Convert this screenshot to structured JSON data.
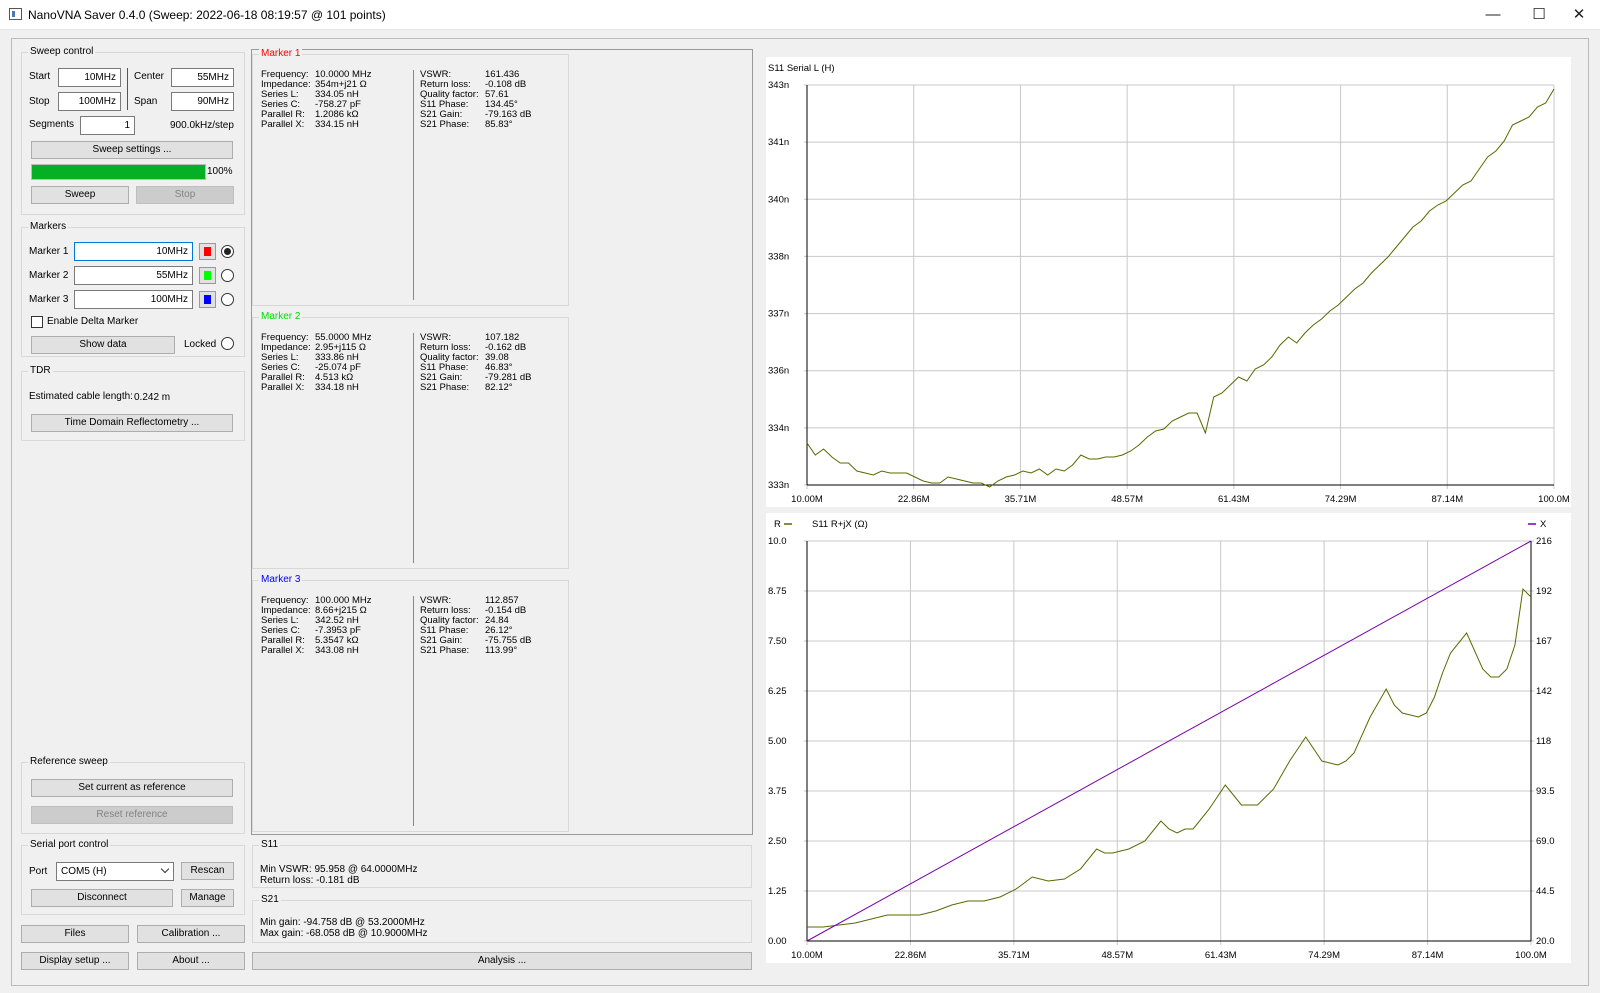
{
  "window": {
    "title": "NanoVNA Saver 0.4.0 (Sweep: 2022-06-18 08:19:57 @ 101 points)"
  },
  "sweep_control": {
    "title": "Sweep control",
    "start_label": "Start",
    "start": "10MHz",
    "center_label": "Center",
    "center": "55MHz",
    "stop_label": "Stop",
    "stop": "100MHz",
    "span_label": "Span",
    "span": "90MHz",
    "segments_label": "Segments",
    "segments": "1",
    "step": "900.0kHz/step",
    "settings_button": "Sweep settings ...",
    "progress": 100,
    "progress_label": "100%",
    "sweep_button": "Sweep",
    "stop_button": "Stop"
  },
  "markers": {
    "title": "Markers",
    "items": [
      {
        "label": "Marker 1",
        "value": "10MHz",
        "color": "#ff0000",
        "selected": true
      },
      {
        "label": "Marker 2",
        "value": "55MHz",
        "color": "#00ff00",
        "selected": false
      },
      {
        "label": "Marker 3",
        "value": "100MHz",
        "color": "#0000ff",
        "selected": false
      }
    ],
    "delta_label": "Enable Delta Marker",
    "show_data": "Show data",
    "locked": "Locked"
  },
  "tdr": {
    "title": "TDR",
    "cable_label": "Estimated cable length:",
    "cable_value": "0.242 m",
    "button": "Time Domain Reflectometry ..."
  },
  "reference": {
    "title": "Reference sweep",
    "set_button": "Set current as reference",
    "reset_button": "Reset reference"
  },
  "serial": {
    "title": "Serial port control",
    "port_label": "Port",
    "port_value": "COM5 (H)",
    "rescan": "Rescan",
    "disconnect": "Disconnect",
    "manage": "Manage"
  },
  "bottom_buttons": {
    "files": "Files",
    "calibration": "Calibration ...",
    "display": "Display setup ...",
    "about": "About ...",
    "analysis": "Analysis ..."
  },
  "marker_panels": [
    {
      "title": "Marker 1",
      "color": "#ff0000",
      "left": [
        [
          "Frequency:",
          "10.0000 MHz"
        ],
        [
          "Impedance:",
          "354m+j21 Ω"
        ],
        [
          "Series L:",
          "334.05 nH"
        ],
        [
          "Series C:",
          "-758.27 pF"
        ],
        [
          "Parallel R:",
          "1.2086 kΩ"
        ],
        [
          "Parallel X:",
          "334.15 nH"
        ]
      ],
      "right": [
        [
          "VSWR:",
          "161.436"
        ],
        [
          "Return loss:",
          "-0.108 dB"
        ],
        [
          "Quality factor:",
          "57.61"
        ],
        [
          "S11 Phase:",
          "134.45°"
        ],
        [
          "S21 Gain:",
          "-79.163 dB"
        ],
        [
          "S21 Phase:",
          "85.83°"
        ]
      ]
    },
    {
      "title": "Marker 2",
      "color": "#00ff00",
      "left": [
        [
          "Frequency:",
          "55.0000 MHz"
        ],
        [
          "Impedance:",
          "2.95+j115 Ω"
        ],
        [
          "Series L:",
          "333.86 nH"
        ],
        [
          "Series C:",
          "-25.074 pF"
        ],
        [
          "Parallel R:",
          "4.513 kΩ"
        ],
        [
          "Parallel X:",
          "334.18 nH"
        ]
      ],
      "right": [
        [
          "VSWR:",
          "107.182"
        ],
        [
          "Return loss:",
          "-0.162 dB"
        ],
        [
          "Quality factor:",
          "39.08"
        ],
        [
          "S11 Phase:",
          "46.83°"
        ],
        [
          "S21 Gain:",
          "-79.281 dB"
        ],
        [
          "S21 Phase:",
          "82.12°"
        ]
      ]
    },
    {
      "title": "Marker 3",
      "color": "#0000ff",
      "left": [
        [
          "Frequency:",
          "100.000 MHz"
        ],
        [
          "Impedance:",
          "8.66+j215 Ω"
        ],
        [
          "Series L:",
          "342.52 nH"
        ],
        [
          "Series C:",
          "-7.3953 pF"
        ],
        [
          "Parallel R:",
          "5.3547 kΩ"
        ],
        [
          "Parallel X:",
          "343.08 nH"
        ]
      ],
      "right": [
        [
          "VSWR:",
          "112.857"
        ],
        [
          "Return loss:",
          "-0.154 dB"
        ],
        [
          "Quality factor:",
          "24.84"
        ],
        [
          "S11 Phase:",
          "26.12°"
        ],
        [
          "S21 Gain:",
          "-75.755 dB"
        ],
        [
          "S21 Phase:",
          "113.99°"
        ]
      ]
    }
  ],
  "s11_summary": {
    "title": "S11",
    "line1": "Min VSWR:  95.958 @ 64.0000MHz",
    "line2": "Return loss:  -0.181 dB"
  },
  "s21_summary": {
    "title": "S21",
    "line1": "Min gain:  -94.758 dB @ 53.2000MHz",
    "line2": "Max gain:  -68.058 dB @ 10.9000MHz"
  },
  "colors": {
    "trace": "#556b00",
    "x_trace": "#7700aa",
    "grid": "#c8c8c8"
  },
  "chart_data": [
    {
      "type": "line",
      "title": "S11 Serial L (H)",
      "x_ticks": [
        "10.00M",
        "22.86M",
        "35.71M",
        "48.57M",
        "61.43M",
        "74.29M",
        "87.14M",
        "100.0M"
      ],
      "y_ticks": [
        "343n",
        "341n",
        "340n",
        "338n",
        "337n",
        "336n",
        "334n",
        "333n"
      ],
      "xlim": [
        10,
        100
      ],
      "ylim": [
        333,
        343
      ],
      "series": [
        {
          "x": [
            10,
            11,
            12,
            13,
            14,
            15,
            16,
            17,
            18,
            19,
            20,
            21,
            22,
            23,
            24,
            25,
            26,
            27,
            28,
            29,
            30,
            31,
            32,
            33,
            34,
            35,
            36,
            37,
            38,
            39,
            40,
            41,
            42,
            43,
            44,
            45,
            46,
            47,
            48,
            49,
            50,
            51,
            52,
            53,
            54,
            55,
            56,
            57,
            58,
            59,
            60,
            61,
            62,
            63,
            64,
            65,
            66,
            67,
            68,
            69,
            70,
            71,
            72,
            73,
            74,
            75,
            76,
            77,
            78,
            79,
            80,
            81,
            82,
            83,
            84,
            85,
            86,
            87,
            88,
            89,
            90,
            91,
            92,
            93,
            94,
            95,
            96,
            97,
            98,
            99,
            100
          ],
          "values": [
            334.05,
            333.75,
            333.9,
            333.7,
            333.55,
            333.55,
            333.35,
            333.3,
            333.25,
            333.35,
            333.3,
            333.3,
            333.3,
            333.2,
            333.1,
            333.05,
            333.05,
            333.2,
            333.15,
            333.1,
            333.05,
            333.05,
            332.95,
            333.1,
            333.2,
            333.25,
            333.35,
            333.3,
            333.4,
            333.25,
            333.4,
            333.35,
            333.5,
            333.75,
            333.65,
            333.65,
            333.7,
            333.7,
            333.75,
            333.85,
            334,
            334.2,
            334.35,
            334.4,
            334.6,
            334.7,
            334.8,
            334.8,
            334.3,
            335.2,
            335.3,
            335.5,
            335.7,
            335.6,
            335.9,
            336,
            336.2,
            336.5,
            336.7,
            336.55,
            336.8,
            337,
            337.15,
            337.35,
            337.5,
            337.7,
            337.9,
            338.05,
            338.3,
            338.5,
            338.7,
            338.95,
            339.2,
            339.45,
            339.6,
            339.85,
            340,
            340.1,
            340.3,
            340.5,
            340.6,
            340.9,
            341.2,
            341.35,
            341.6,
            342,
            342.1,
            342.2,
            342.45,
            342.55,
            342.9
          ]
        }
      ]
    },
    {
      "type": "line",
      "title": "S11 R+jX (Ω)",
      "legend": [
        "R",
        "X"
      ],
      "x_ticks": [
        "10.00M",
        "22.86M",
        "35.71M",
        "48.57M",
        "61.43M",
        "74.29M",
        "87.14M",
        "100.0M"
      ],
      "y_ticks_left": [
        "10.0",
        "8.75",
        "7.50",
        "6.25",
        "5.00",
        "3.75",
        "2.50",
        "1.25",
        "0.00"
      ],
      "y_ticks_right": [
        "216",
        "192",
        "167",
        "142",
        "118",
        "93.5",
        "69.0",
        "44.5",
        "20.0"
      ],
      "xlim": [
        10,
        100
      ],
      "ylim_left": [
        0,
        10
      ],
      "ylim_right": [
        20,
        216
      ],
      "series": [
        {
          "name": "R",
          "axis": "left",
          "x": [
            10,
            12,
            14,
            16,
            18,
            20,
            22,
            24,
            26,
            28,
            30,
            32,
            34,
            36,
            38,
            40,
            42,
            44,
            46,
            47,
            48,
            50,
            52,
            54,
            55,
            56,
            57,
            58,
            60,
            62,
            64,
            65,
            66,
            68,
            70,
            72,
            73,
            74,
            76,
            77,
            78,
            80,
            82,
            83,
            84,
            86,
            87,
            88,
            89,
            90,
            92,
            94,
            95,
            96,
            97,
            98,
            99,
            100
          ],
          "values": [
            0.35,
            0.35,
            0.4,
            0.45,
            0.55,
            0.65,
            0.65,
            0.65,
            0.75,
            0.9,
            1.0,
            1.0,
            1.1,
            1.3,
            1.6,
            1.5,
            1.55,
            1.8,
            2.3,
            2.2,
            2.2,
            2.3,
            2.5,
            3.0,
            2.8,
            2.7,
            2.8,
            2.8,
            3.3,
            3.9,
            3.4,
            3.4,
            3.4,
            3.8,
            4.5,
            5.1,
            4.8,
            4.5,
            4.4,
            4.5,
            4.7,
            5.6,
            6.3,
            5.9,
            5.7,
            5.6,
            5.7,
            6.1,
            6.7,
            7.2,
            7.7,
            6.8,
            6.6,
            6.6,
            6.8,
            7.4,
            8.8,
            8.6
          ]
        },
        {
          "name": "X",
          "axis": "right",
          "x": [
            10,
            100
          ],
          "values": [
            20,
            216
          ]
        }
      ]
    }
  ]
}
